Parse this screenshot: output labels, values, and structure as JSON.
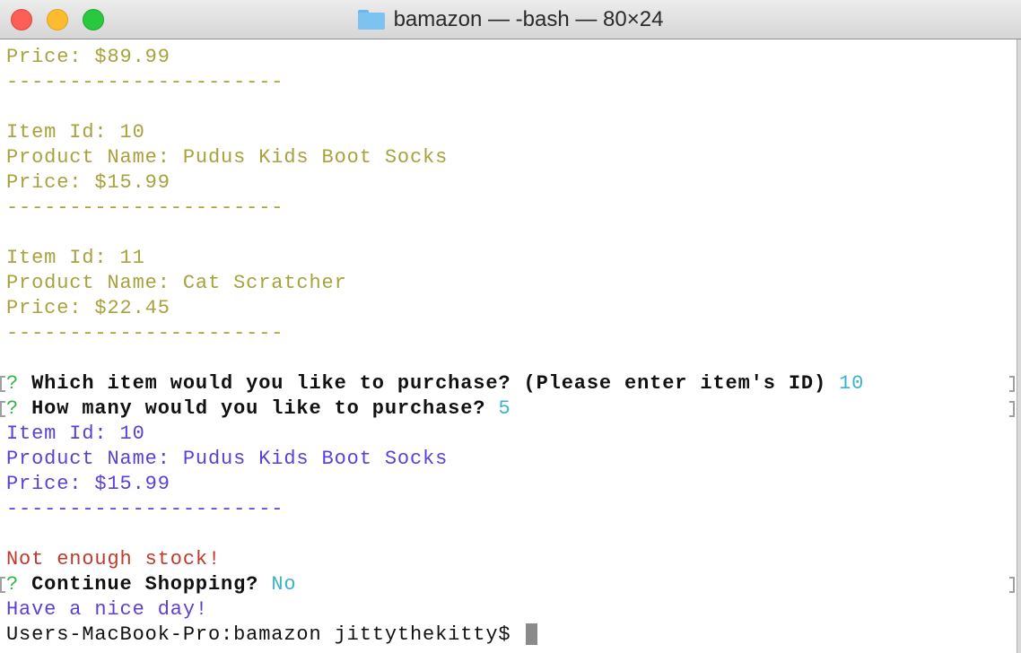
{
  "window": {
    "title": "bamazon — -bash — 80×24",
    "folder_icon": "folder-icon"
  },
  "terminal": {
    "lines": [
      {
        "text": "Price: $89.99"
      },
      {
        "text": "----------------------"
      },
      {
        "text": ""
      },
      {
        "text": "Item Id: 10"
      },
      {
        "text": "Product Name: Pudus Kids Boot Socks"
      },
      {
        "text": "Price: $15.99"
      },
      {
        "text": "----------------------"
      },
      {
        "text": ""
      },
      {
        "text": "Item Id: 11"
      },
      {
        "text": "Product Name: Cat Scratcher"
      },
      {
        "text": "Price: $22.45"
      },
      {
        "text": "----------------------"
      }
    ],
    "prompt1": {
      "marker": "?",
      "question": "Which item would you like to purchase? (Please enter item's ID)",
      "answer": "10"
    },
    "prompt2": {
      "marker": "?",
      "question": "How many would you like to purchase?",
      "answer": "5"
    },
    "selected": [
      {
        "text": "Item Id: 10"
      },
      {
        "text": "Product Name: Pudus Kids Boot Socks"
      },
      {
        "text": "Price: $15.99"
      },
      {
        "text": "----------------------"
      }
    ],
    "error": "Not enough stock!",
    "prompt3": {
      "marker": "?",
      "question": "Continue Shopping?",
      "answer": "No"
    },
    "farewell": "Have a nice day!",
    "shell_prompt": "Users-MacBook-Pro:bamazon jittythekitty$"
  },
  "colors": {
    "listing": "#a8a23c",
    "selected": "#5b3fd6",
    "error": "#c0392b",
    "prompt_marker": "#2fb54a",
    "answer": "#3cb4c8"
  }
}
